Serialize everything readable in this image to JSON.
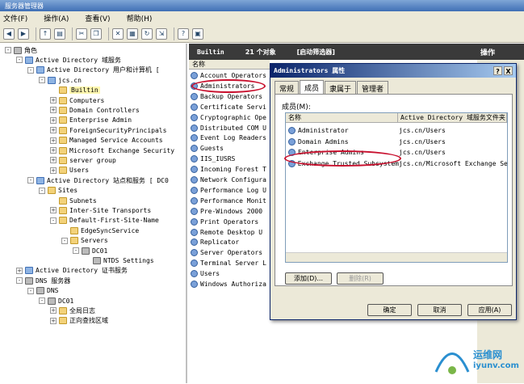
{
  "window": {
    "title": "服务器管理器"
  },
  "menu": {
    "file": "文件(F)",
    "action": "操作(A)",
    "view": "查看(V)",
    "help": "帮助(H)"
  },
  "tree": [
    {
      "label": "角色",
      "depth": 0,
      "exp": "-",
      "icon": "srv"
    },
    {
      "label": "Active Directory 域服务",
      "depth": 1,
      "exp": "-",
      "icon": "ad"
    },
    {
      "label": "Active Directory 用户和计算机 [",
      "depth": 2,
      "exp": "-",
      "icon": "ad"
    },
    {
      "label": "jcs.cn",
      "depth": 3,
      "exp": "-",
      "icon": "ad"
    },
    {
      "label": "Builtin",
      "depth": 4,
      "exp": "",
      "icon": "folder",
      "sel": true
    },
    {
      "label": "Computers",
      "depth": 4,
      "exp": "+",
      "icon": "folder"
    },
    {
      "label": "Domain Controllers",
      "depth": 4,
      "exp": "+",
      "icon": "folder"
    },
    {
      "label": "Enterprise Admin",
      "depth": 4,
      "exp": "+",
      "icon": "folder"
    },
    {
      "label": "ForeignSecurityPrincipals",
      "depth": 4,
      "exp": "+",
      "icon": "folder"
    },
    {
      "label": "Managed Service Accounts",
      "depth": 4,
      "exp": "+",
      "icon": "folder"
    },
    {
      "label": "Microsoft Exchange Security",
      "depth": 4,
      "exp": "+",
      "icon": "folder"
    },
    {
      "label": "server group",
      "depth": 4,
      "exp": "+",
      "icon": "folder"
    },
    {
      "label": "Users",
      "depth": 4,
      "exp": "+",
      "icon": "folder"
    },
    {
      "label": "Active Directory 站点和服务 [ DC0",
      "depth": 2,
      "exp": "-",
      "icon": "ad"
    },
    {
      "label": "Sites",
      "depth": 3,
      "exp": "-",
      "icon": "folder"
    },
    {
      "label": "Subnets",
      "depth": 4,
      "exp": "",
      "icon": "folder"
    },
    {
      "label": "Inter-Site Transports",
      "depth": 4,
      "exp": "+",
      "icon": "folder"
    },
    {
      "label": "Default-First-Site-Name",
      "depth": 4,
      "exp": "-",
      "icon": "folder"
    },
    {
      "label": "EdgeSyncService",
      "depth": 5,
      "exp": "",
      "icon": "folder"
    },
    {
      "label": "Servers",
      "depth": 5,
      "exp": "-",
      "icon": "folder"
    },
    {
      "label": "DC01",
      "depth": 6,
      "exp": "-",
      "icon": "srv"
    },
    {
      "label": "NTDS Settings",
      "depth": 7,
      "exp": "",
      "icon": "srv"
    },
    {
      "label": "Active Directory 证书服务",
      "depth": 1,
      "exp": "+",
      "icon": "ad"
    },
    {
      "label": "DNS 服务器",
      "depth": 1,
      "exp": "-",
      "icon": "srv"
    },
    {
      "label": "DNS",
      "depth": 2,
      "exp": "-",
      "icon": "srv"
    },
    {
      "label": "DC01",
      "depth": 3,
      "exp": "-",
      "icon": "srv"
    },
    {
      "label": "全局日志",
      "depth": 4,
      "exp": "+",
      "icon": "folder"
    },
    {
      "label": "正向查找区域",
      "depth": 4,
      "exp": "+",
      "icon": "folder"
    }
  ],
  "listHeader": {
    "name": "Builtin",
    "count": "21 个对象",
    "filter": "[启动筛选器]"
  },
  "actionsHeader": "操作",
  "colName": "名称",
  "list": [
    "Account Operators",
    "Administrators",
    "Backup Operators",
    "Certificate Servi",
    "Cryptographic Ope",
    "Distributed COM U",
    "Event Log Readers",
    "Guests",
    "IIS_IUSRS",
    "Incoming Forest T",
    "Network Configura",
    "Performance Log U",
    "Performance Monit",
    "Pre-Windows 2000",
    "Print Operators",
    "Remote Desktop U",
    "Replicator",
    "Server Operators",
    "Terminal Server L",
    "Users",
    "Windows Authoriza"
  ],
  "dialog": {
    "title": "Administrators 属性",
    "tabs": [
      "常规",
      "成员",
      "隶属于",
      "管理者"
    ],
    "membersLabel": "成员(M):",
    "colName": "名称",
    "colFolder": "Active Directory 域服务文件夹",
    "members": [
      {
        "name": "Administrator",
        "folder": "jcs.cn/Users"
      },
      {
        "name": "Domain Admins",
        "folder": "jcs.cn/Users"
      },
      {
        "name": "Enterprise Admins",
        "folder": "jcs.cn/Users"
      },
      {
        "name": "Exchange Trusted Subsystem",
        "folder": "jcs.cn/Microsoft Exchange Se"
      }
    ],
    "add": "添加(D)...",
    "remove": "删除(R)",
    "ok": "确定",
    "cancel": "取消",
    "apply": "应用(A)",
    "help": "?",
    "close": "X"
  },
  "watermark": {
    "name": "运维网",
    "url": "iyunv.com"
  },
  "colors": {
    "highlight": "#c8102e",
    "titleBlue": "#0a246a"
  }
}
